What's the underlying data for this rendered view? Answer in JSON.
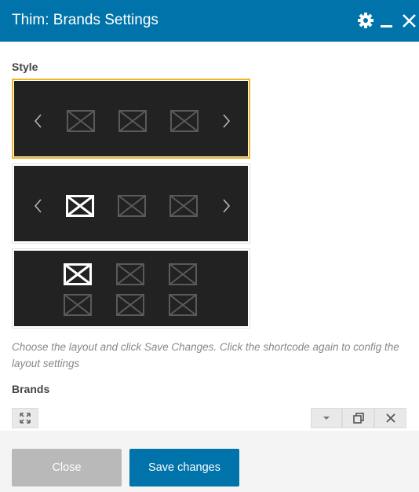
{
  "dialog": {
    "title": "Thim: Brands Settings"
  },
  "style_section": {
    "label": "Style",
    "options": [
      {
        "name": "carousel-with-arrows",
        "selected": true
      },
      {
        "name": "carousel-with-arrows-highlight",
        "selected": false
      },
      {
        "name": "grid-two-rows",
        "selected": false
      }
    ],
    "hint": "Choose the layout and click Save Changes. Click the shortcode again to config the layout settings"
  },
  "brands_section": {
    "label": "Brands"
  },
  "footer": {
    "close_label": "Close",
    "save_label": "Save changes"
  },
  "colors": {
    "header": "#0073aa",
    "selected_border": "#f0b429",
    "preview_bg": "#222222",
    "save_button": "#0073aa",
    "close_button": "#b9b9b9"
  },
  "icons": [
    "gear-icon",
    "minimize-icon",
    "close-icon",
    "expand-icon",
    "caret-down-icon",
    "clone-icon",
    "remove-icon"
  ]
}
